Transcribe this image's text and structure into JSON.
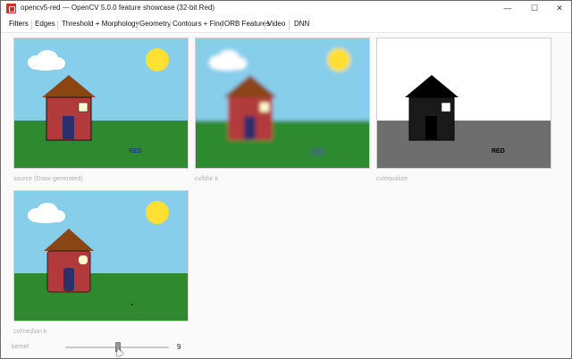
{
  "window": {
    "title": "opencv5-red — OpenCV 5.0.0 feature showcase (32-bit Red)",
    "buttons": {
      "minimize": "—",
      "maximize": "☐",
      "close": "✕"
    }
  },
  "tabs": [
    {
      "label": "Filters",
      "active": true
    },
    {
      "label": "Edges"
    },
    {
      "label": "Threshold + Morphology"
    },
    {
      "label": "Geometry"
    },
    {
      "label": "Contours + Find"
    },
    {
      "label": "ORB Features"
    },
    {
      "label": "Video"
    },
    {
      "label": "DNN"
    }
  ],
  "panels": [
    {
      "caption": "source (Draw-generated)",
      "variant": "source",
      "overlay_text": "RED"
    },
    {
      "caption": "cv/blur k",
      "variant": "blur",
      "overlay_text": "RED"
    },
    {
      "caption": "cv/equalize",
      "variant": "equalize",
      "overlay_text": "RED"
    },
    {
      "caption": "cv/median k",
      "variant": "median",
      "overlay_text": ""
    }
  ],
  "trackbar": {
    "label": "kernel",
    "value": "9",
    "level": 0.5
  },
  "colors": {
    "sky": "#87ceeb",
    "grass": "#2f8a2f",
    "house": "#b23a3a",
    "roof": "#8b4513",
    "door": "#2b2f6b",
    "sun": "#ffe033",
    "gray_bg": "#6e6e6e"
  }
}
